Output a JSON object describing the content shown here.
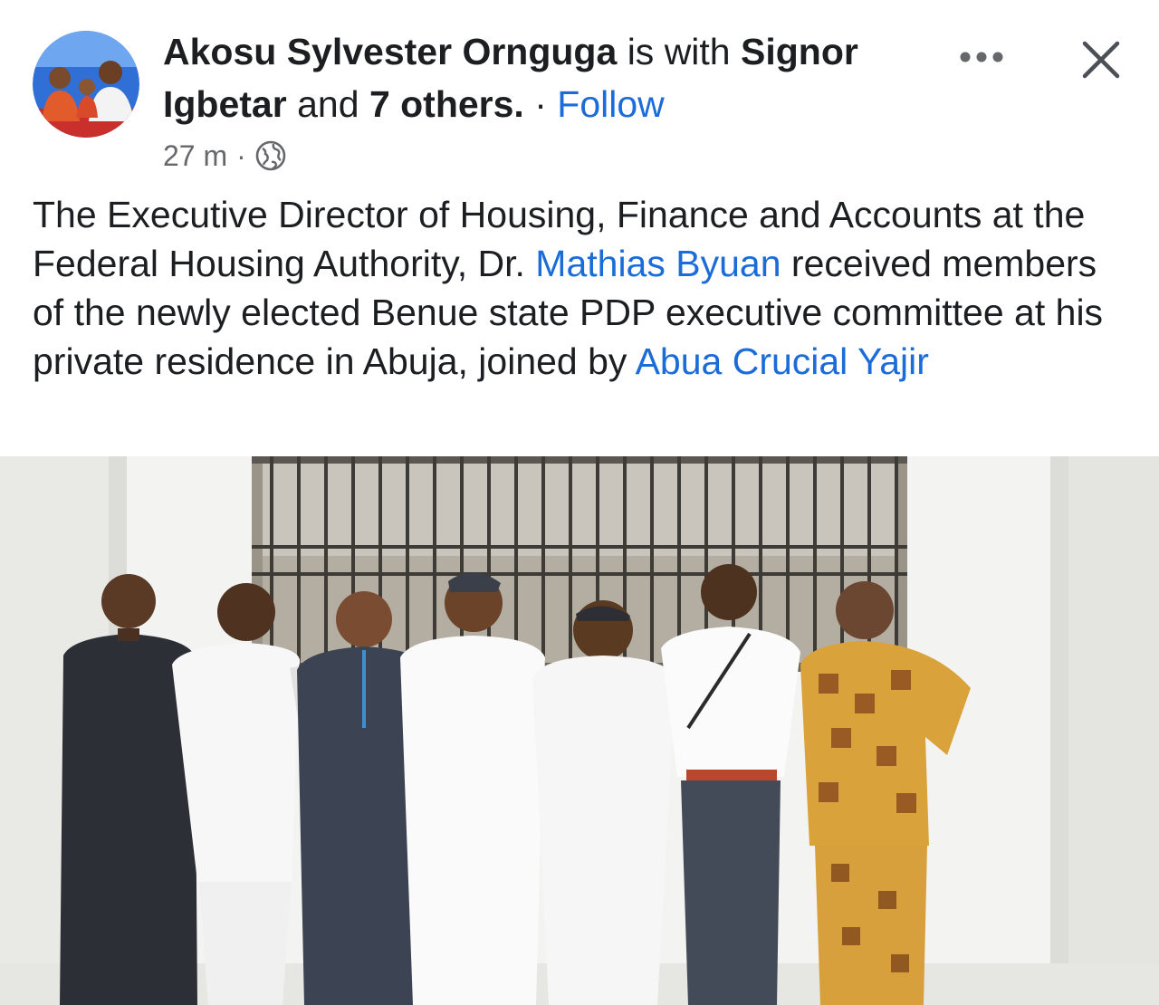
{
  "post": {
    "author": "Akosu Sylvester Ornguga",
    "with_text": "is with",
    "tagged_person": "Signor Igbetar",
    "and_text": "and",
    "others": "7 others.",
    "dot": "·",
    "follow_label": "Follow",
    "time": "27 m",
    "time_sep": "·",
    "privacy_icon": "globe-icon",
    "text_part1": "The Executive Director of Housing, Finance and Accounts at the Federal Housing Authority, Dr.",
    "mention1": "Mathias Byuan",
    "text_part2": "received members of the newly elected Benue state PDP executive committee at his private residence in Abuja, joined by",
    "mention2": "Abua Crucial Yajir"
  },
  "actions": {
    "more_icon": "more-horizontal-icon",
    "close_icon": "close-icon"
  },
  "colors": {
    "link": "#1b6cd9",
    "text": "#1c1e21",
    "secondary": "#65676b"
  }
}
